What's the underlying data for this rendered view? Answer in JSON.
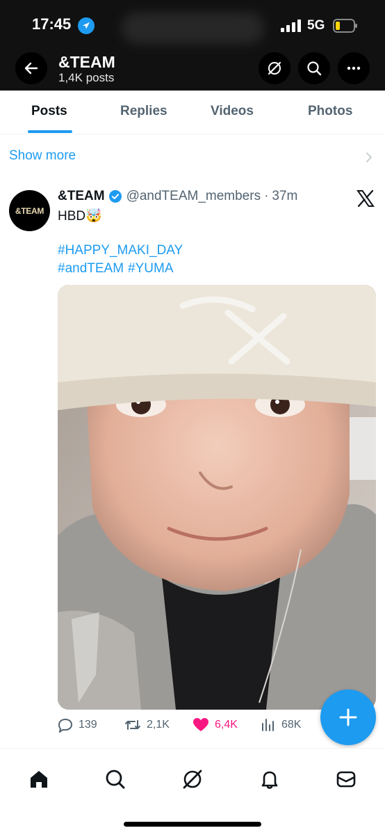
{
  "status_bar": {
    "time": "17:45",
    "network": "5G"
  },
  "header": {
    "title": "&TEAM",
    "subtitle": "1,4K posts"
  },
  "tabs": [
    {
      "label": "Posts",
      "active": true
    },
    {
      "label": "Replies",
      "active": false
    },
    {
      "label": "Videos",
      "active": false
    },
    {
      "label": "Photos",
      "active": false
    }
  ],
  "show_more": "Show more",
  "tweet": {
    "avatar_text": "&TEAM",
    "author_name": "&TEAM",
    "handle": "@andTEAM_members",
    "separator": "·",
    "time": "37m",
    "text": "HBD🤯",
    "hashtags_line1": "#HAPPY_MAKI_DAY",
    "hashtags_line2_a": "#andTEAM",
    "hashtags_line2_b": "#YUMA",
    "stats": {
      "replies": "139",
      "reposts": "2,1K",
      "likes": "6,4K",
      "views": "68K"
    }
  },
  "colors": {
    "accent": "#1d9bf0",
    "like": "#f91880",
    "header_bg": "#111111",
    "muted": "#536471"
  }
}
